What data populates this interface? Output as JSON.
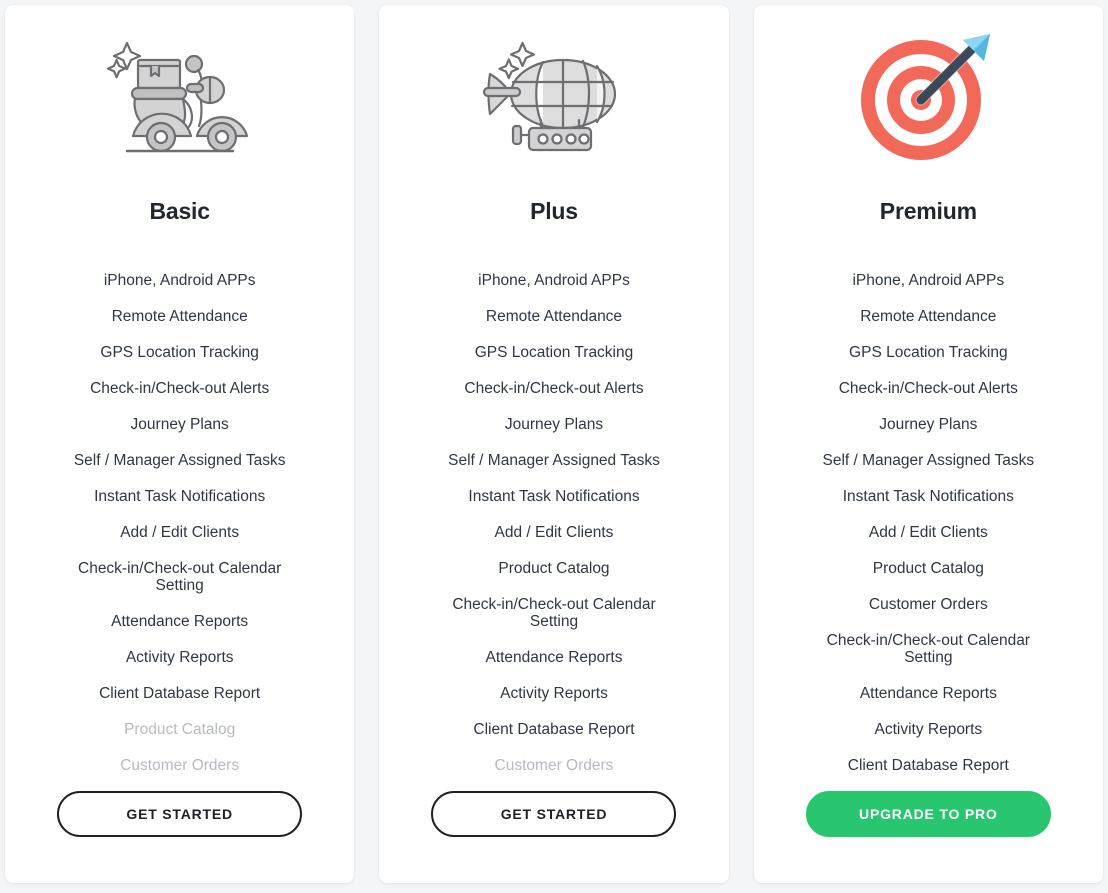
{
  "theme": {
    "page_background": "#f4f5f7",
    "card_background": "#ffffff",
    "text_color": "#303742",
    "disabled_text_color": "#b6bac0",
    "accent_green": "#28c76f",
    "accent_red": "#f2695a",
    "icon_gray": "#d6d6d6",
    "icon_stroke": "#6d6e71",
    "arrow_blue": "#6dc5ee",
    "arrow_navy": "#3b4a5a"
  },
  "plans": [
    {
      "id": "basic",
      "title": "Basic",
      "icon": "scooter-icon",
      "cta": {
        "label": "GET STARTED",
        "style": "outline",
        "name": "get-started-button"
      },
      "features": [
        {
          "label": "iPhone, Android APPs",
          "enabled": true
        },
        {
          "label": "Remote Attendance",
          "enabled": true
        },
        {
          "label": "GPS Location Tracking",
          "enabled": true
        },
        {
          "label": "Check-in/Check-out Alerts",
          "enabled": true
        },
        {
          "label": "Journey Plans",
          "enabled": true
        },
        {
          "label": "Self / Manager Assigned Tasks",
          "enabled": true
        },
        {
          "label": "Instant Task Notifications",
          "enabled": true
        },
        {
          "label": "Add / Edit Clients",
          "enabled": true
        },
        {
          "label": "Check-in/Check-out Calendar\nSetting",
          "enabled": true
        },
        {
          "label": "Attendance Reports",
          "enabled": true
        },
        {
          "label": "Activity Reports",
          "enabled": true
        },
        {
          "label": "Client Database Report",
          "enabled": true
        },
        {
          "label": "Product Catalog",
          "enabled": false
        },
        {
          "label": "Customer Orders",
          "enabled": false
        }
      ]
    },
    {
      "id": "plus",
      "title": "Plus",
      "icon": "zeppelin-icon",
      "cta": {
        "label": "GET STARTED",
        "style": "outline",
        "name": "get-started-button"
      },
      "features": [
        {
          "label": "iPhone, Android APPs",
          "enabled": true
        },
        {
          "label": "Remote Attendance",
          "enabled": true
        },
        {
          "label": "GPS Location Tracking",
          "enabled": true
        },
        {
          "label": "Check-in/Check-out Alerts",
          "enabled": true
        },
        {
          "label": "Journey Plans",
          "enabled": true
        },
        {
          "label": "Self / Manager Assigned Tasks",
          "enabled": true
        },
        {
          "label": "Instant Task Notifications",
          "enabled": true
        },
        {
          "label": "Add / Edit Clients",
          "enabled": true
        },
        {
          "label": "Product Catalog",
          "enabled": true
        },
        {
          "label": "Check-in/Check-out Calendar\nSetting",
          "enabled": true
        },
        {
          "label": "Attendance Reports",
          "enabled": true
        },
        {
          "label": "Activity Reports",
          "enabled": true
        },
        {
          "label": "Client Database Report",
          "enabled": true
        },
        {
          "label": "Customer Orders",
          "enabled": false
        }
      ]
    },
    {
      "id": "premium",
      "title": "Premium",
      "icon": "target-arrow-icon",
      "cta": {
        "label": "UPGRADE TO PRO",
        "style": "filled",
        "name": "upgrade-to-pro-button"
      },
      "features": [
        {
          "label": "iPhone, Android APPs",
          "enabled": true
        },
        {
          "label": "Remote Attendance",
          "enabled": true
        },
        {
          "label": "GPS Location Tracking",
          "enabled": true
        },
        {
          "label": "Check-in/Check-out Alerts",
          "enabled": true
        },
        {
          "label": "Journey Plans",
          "enabled": true
        },
        {
          "label": "Self / Manager Assigned Tasks",
          "enabled": true
        },
        {
          "label": "Instant Task Notifications",
          "enabled": true
        },
        {
          "label": "Add / Edit Clients",
          "enabled": true
        },
        {
          "label": "Product Catalog",
          "enabled": true
        },
        {
          "label": "Customer Orders",
          "enabled": true
        },
        {
          "label": "Check-in/Check-out Calendar\nSetting",
          "enabled": true
        },
        {
          "label": "Attendance Reports",
          "enabled": true
        },
        {
          "label": "Activity Reports",
          "enabled": true
        },
        {
          "label": "Client Database Report",
          "enabled": true
        }
      ]
    }
  ]
}
